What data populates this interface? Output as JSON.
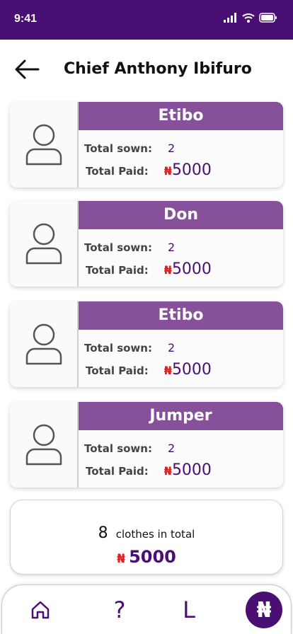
{
  "status": {
    "time": "9:41"
  },
  "header": {
    "title": "Chief Anthony Ibifuro"
  },
  "labels": {
    "total_sown": "Total sown:",
    "total_paid": "Total Paid:",
    "currency": "₦"
  },
  "items": [
    {
      "name": "Etibo",
      "sown": "2",
      "paid": "5000"
    },
    {
      "name": "Don",
      "sown": "2",
      "paid": "5000"
    },
    {
      "name": "Etibo",
      "sown": "2",
      "paid": "5000"
    },
    {
      "name": "Jumper",
      "sown": "2",
      "paid": "5000"
    }
  ],
  "summary": {
    "count": "8",
    "text": "clothes in total",
    "currency": "₦",
    "total": "5000"
  },
  "nav": {
    "help": "?",
    "ledger": "L",
    "payment": "₦",
    "icons": [
      "home-icon",
      "help-icon",
      "ledger-icon",
      "naira-icon"
    ]
  },
  "colors": {
    "primary": "#4a0f72",
    "card_header": "#86509a",
    "currency": "#e02020"
  }
}
